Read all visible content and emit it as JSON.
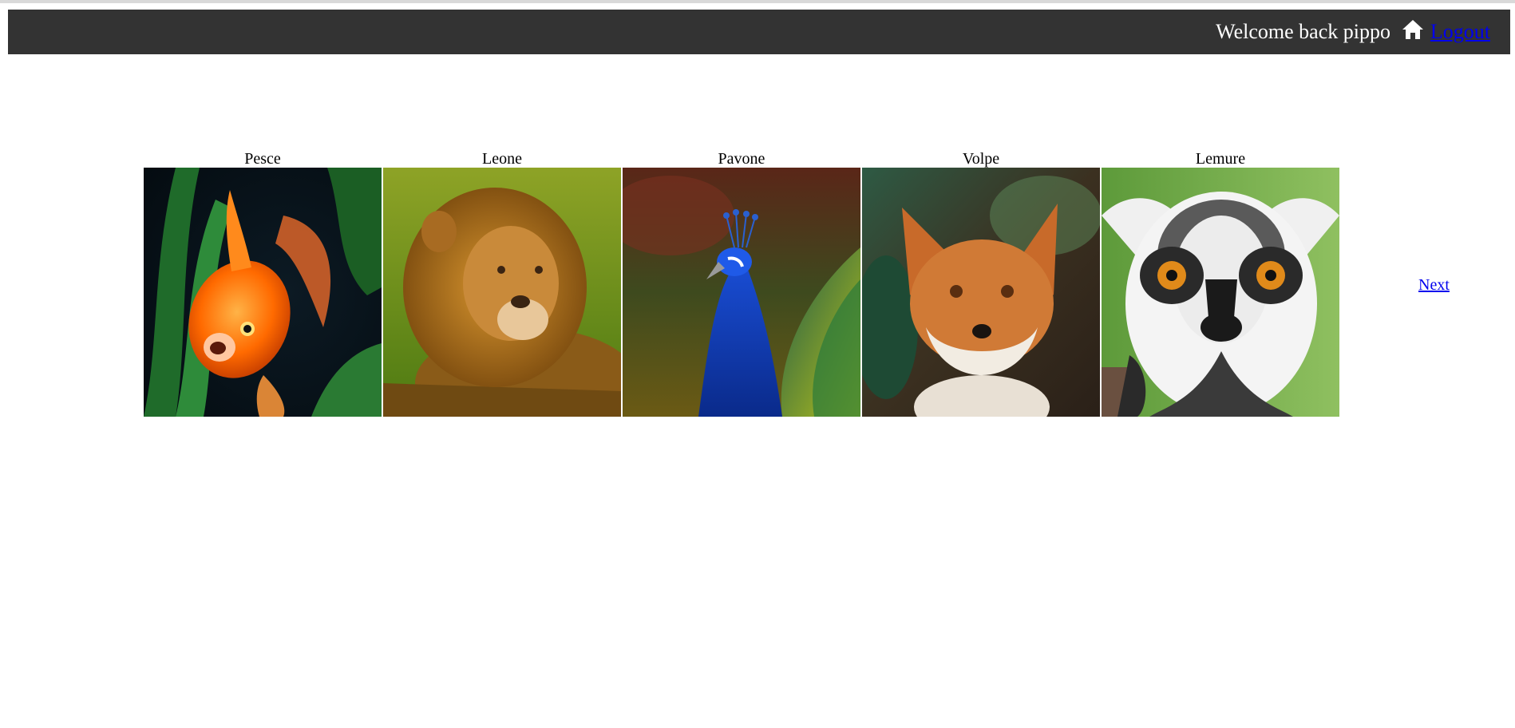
{
  "header": {
    "welcome_text": "Welcome back pippo",
    "home_icon": "home-icon",
    "logout_label": "Logout",
    "background": "#333333",
    "link_color": "#0000ee"
  },
  "gallery": {
    "items": [
      {
        "title": "Pesce",
        "image": "goldfish"
      },
      {
        "title": "Leone",
        "image": "lion"
      },
      {
        "title": "Pavone",
        "image": "peacock"
      },
      {
        "title": "Volpe",
        "image": "fox"
      },
      {
        "title": "Lemure",
        "image": "lemur"
      }
    ],
    "next_label": "Next"
  }
}
